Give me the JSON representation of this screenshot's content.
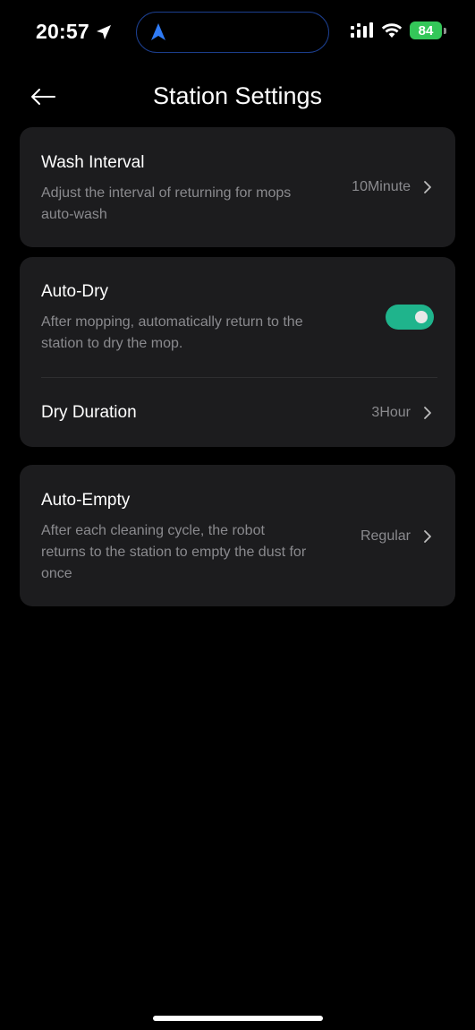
{
  "status_bar": {
    "time": "20:57",
    "battery_level": "84",
    "icons": [
      "location-arrow-icon",
      "navigation-icon",
      "signal-icon",
      "wifi-icon",
      "battery-icon"
    ]
  },
  "header": {
    "title": "Station Settings",
    "back_icon": "arrow-left-icon"
  },
  "wash_interval": {
    "title": "Wash Interval",
    "description": "Adjust the interval of returning for mops auto-wash",
    "value": "10Minute"
  },
  "auto_dry": {
    "title": "Auto-Dry",
    "description": "After mopping, automatically return to the  station to dry the mop.",
    "enabled": true,
    "dry_duration_label": "Dry Duration",
    "dry_duration_value": "3Hour"
  },
  "auto_empty": {
    "title": "Auto-Empty",
    "description": "After each cleaning cycle, the robot returns to the station to empty the dust for once",
    "value": "Regular"
  },
  "colors": {
    "background": "#000000",
    "card": "#1c1c1e",
    "toggle_on": "#1fb48c",
    "battery": "#34c759",
    "secondary_text": "#8a8a8e",
    "island_border": "#1c3f8f"
  }
}
